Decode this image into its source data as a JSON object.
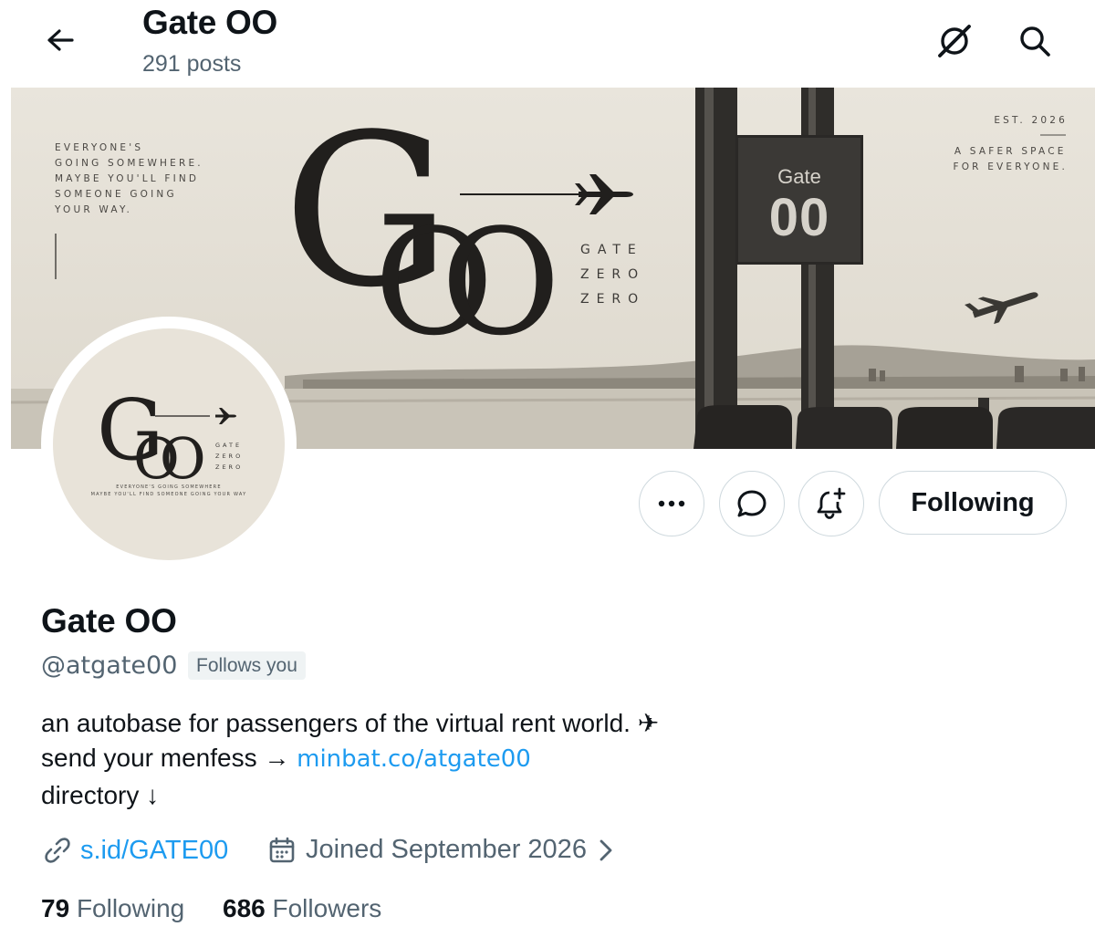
{
  "header": {
    "title": "Gate OO",
    "post_count": "291 posts"
  },
  "banner": {
    "left_tagline": [
      "EVERYONE'S",
      "GOING SOMEWHERE.",
      "MAYBE YOU'LL FIND",
      "SOMEONE GOING",
      "YOUR WAY."
    ],
    "est": "EST. 2026",
    "right_tagline": [
      "A SAFER SPACE",
      "FOR EVERYONE."
    ],
    "logo_g": "G",
    "logo_oo": "OO",
    "stack_words": [
      "GATE",
      "ZERO",
      "ZERO"
    ],
    "sign_word": "Gate",
    "sign_number": "00"
  },
  "avatar": {
    "logo_g": "G",
    "logo_oo": "OO",
    "stack_words": [
      "GATE",
      "ZERO",
      "ZERO"
    ],
    "tagline_1": "EVERYONE'S GOING SOMEWHERE",
    "tagline_2": "MAYBE YOU'LL FIND SOMEONE GOING YOUR WAY"
  },
  "actions": {
    "following_label": "Following"
  },
  "profile": {
    "name": "Gate OO",
    "handle": "@atgate00",
    "follows_you": "Follows you",
    "bio_line1": "an autobase for passengers of the virtual rent world. ✈",
    "bio_line2_prefix": "send your menfess → ",
    "bio_line2_link": "minbat.co/atgate00",
    "bio_line3": "directory ↓",
    "website": "s.id/GATE00",
    "joined": "Joined September 2026",
    "following_count": "79",
    "following_label": "Following",
    "followers_count": "686",
    "followers_label": "Followers"
  },
  "colors": {
    "accent": "#1d9bf0",
    "muted": "#536471",
    "text": "#0f1419",
    "border": "#cfd9de",
    "banner_bg": "#e6e2d9"
  },
  "icons": {
    "back": "arrow-left-icon",
    "grok": "grok-icon",
    "search": "search-icon",
    "more": "more-icon",
    "message": "message-icon",
    "notify": "bell-plus-icon",
    "link": "link-icon",
    "calendar": "calendar-icon",
    "chevron": "chevron-right-icon"
  }
}
